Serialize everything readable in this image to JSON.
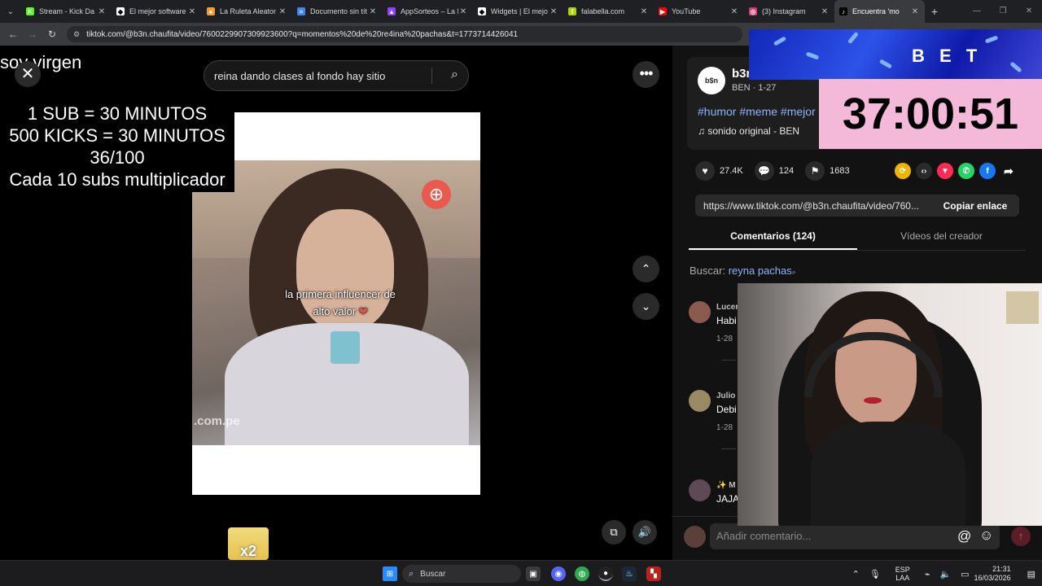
{
  "browser": {
    "tabs": [
      {
        "label": "Stream - Kick Da",
        "fav": "K",
        "color": "#53fc18",
        "active": false
      },
      {
        "label": "El mejor software",
        "fav": "◆",
        "color": "#ffffff",
        "active": false
      },
      {
        "label": "La Ruleta Aleator",
        "fav": "●",
        "color": "#f0a030",
        "active": false
      },
      {
        "label": "Documento sin tít",
        "fav": "≡",
        "color": "#4285f4",
        "active": false
      },
      {
        "label": "AppSorteos – La I",
        "fav": "▲",
        "color": "#8e44ff",
        "active": false
      },
      {
        "label": "Widgets | El mejo",
        "fav": "◆",
        "color": "#ffffff",
        "active": false
      },
      {
        "label": "falabella.com",
        "fav": "f",
        "color": "#aad500",
        "active": false
      },
      {
        "label": "YouTube",
        "fav": "▶",
        "color": "#ff0000",
        "active": false
      },
      {
        "label": "(3) Instagram",
        "fav": "◎",
        "color": "#e1306c",
        "active": false
      },
      {
        "label": "Encuentra 'mo",
        "fav": "♪",
        "color": "#000000",
        "active": true
      }
    ],
    "new_tab": "+",
    "url": "tiktok.com/@b3n.chaufita/video/7600229907309923600?q=momentos%20de%20re4ina%20pachas&t=1773714426041"
  },
  "overlay": {
    "title": "soy virgen",
    "close": "✕",
    "lines": [
      "1 SUB     = 30 MINUTOS",
      "500 KICKS = 30 MINUTOS",
      "36/100",
      "Cada 10 subs multiplicador"
    ]
  },
  "video": {
    "search_text": "reina dando clases al fondo hay sitio",
    "caption_line1": "la primera influencer de",
    "caption_line2": "alto valor",
    "watermark": ".com.pe",
    "more": "•••"
  },
  "creator": {
    "avatar_text": "b$n",
    "name": "b3n",
    "sub": "BEN · 1-27",
    "hashtags": "#humor #meme #mejor",
    "sound": "♫  sonido original - BEN"
  },
  "stats": {
    "likes": "27.4K",
    "comments": "124",
    "saves": "1683"
  },
  "link": {
    "text": "https://www.tiktok.com/@b3n.chaufita/video/760...",
    "button": "Copiar enlace"
  },
  "tabs": {
    "comments": "Comentarios (124)",
    "creator_videos": "Vídeos del creador"
  },
  "comment_search": {
    "label": "Buscar:",
    "term": "reyna pachas"
  },
  "comments": [
    {
      "name": "Lucer",
      "text": "Habi",
      "date": "1-28"
    },
    {
      "name": "Julio",
      "text": "Debi",
      "date": "1-28"
    },
    {
      "name": "✨ M",
      "text": "JAJA",
      "date": ""
    }
  ],
  "add_comment": {
    "placeholder": "Añadir comentario...",
    "at": "@",
    "emoji": "☺",
    "send": "↑"
  },
  "stream": {
    "banner_text": "B E T",
    "timer": "37:00:51",
    "sticker": "x2"
  },
  "taskbar": {
    "search": "Buscar",
    "lang1": "ESP",
    "lang2": "LAA",
    "time": "21:31",
    "date": "16/03/2026"
  }
}
